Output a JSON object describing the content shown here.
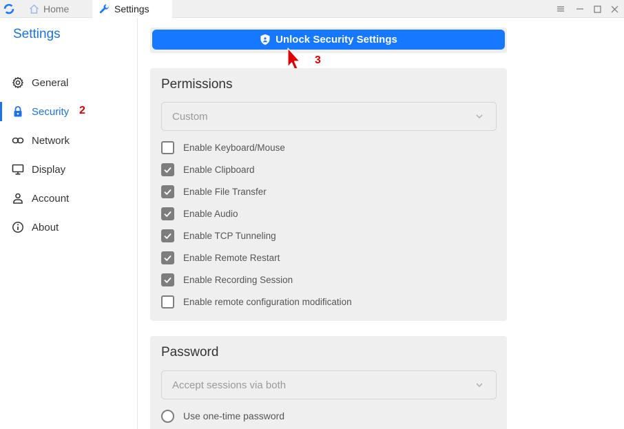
{
  "titlebar": {
    "tabs": [
      {
        "label": "Home",
        "icon": "home-icon"
      },
      {
        "label": "Settings",
        "icon": "wrench-icon"
      }
    ],
    "controls": [
      "menu-icon",
      "minimize-icon",
      "maximize-icon",
      "close-icon"
    ]
  },
  "sidebar": {
    "title": "Settings",
    "items": [
      {
        "label": "General",
        "icon": "gear-icon",
        "active": false
      },
      {
        "label": "Security",
        "icon": "lock-icon",
        "active": true
      },
      {
        "label": "Network",
        "icon": "link-icon",
        "active": false
      },
      {
        "label": "Display",
        "icon": "monitor-icon",
        "active": false
      },
      {
        "label": "Account",
        "icon": "user-icon",
        "active": false
      },
      {
        "label": "About",
        "icon": "info-icon",
        "active": false
      }
    ],
    "step_marker": "2"
  },
  "main": {
    "unlock_label": "Unlock Security Settings",
    "step_marker": "3",
    "permissions": {
      "title": "Permissions",
      "mode_value": "Custom",
      "options": [
        {
          "label": "Enable Keyboard/Mouse",
          "checked": false
        },
        {
          "label": "Enable Clipboard",
          "checked": true
        },
        {
          "label": "Enable File Transfer",
          "checked": true
        },
        {
          "label": "Enable Audio",
          "checked": true
        },
        {
          "label": "Enable TCP Tunneling",
          "checked": true
        },
        {
          "label": "Enable Remote Restart",
          "checked": true
        },
        {
          "label": "Enable Recording Session",
          "checked": true
        },
        {
          "label": "Enable remote configuration modification",
          "checked": false
        }
      ]
    },
    "password": {
      "title": "Password",
      "mode_value": "Accept sessions via both",
      "radio_option": "Use one-time password"
    }
  },
  "colors": {
    "accent": "#1677ff",
    "sidebar_active": "#1a73e8",
    "step_marker": "#e00000",
    "checkbox": "#7d7d7d",
    "card_bg": "#efeff0"
  }
}
